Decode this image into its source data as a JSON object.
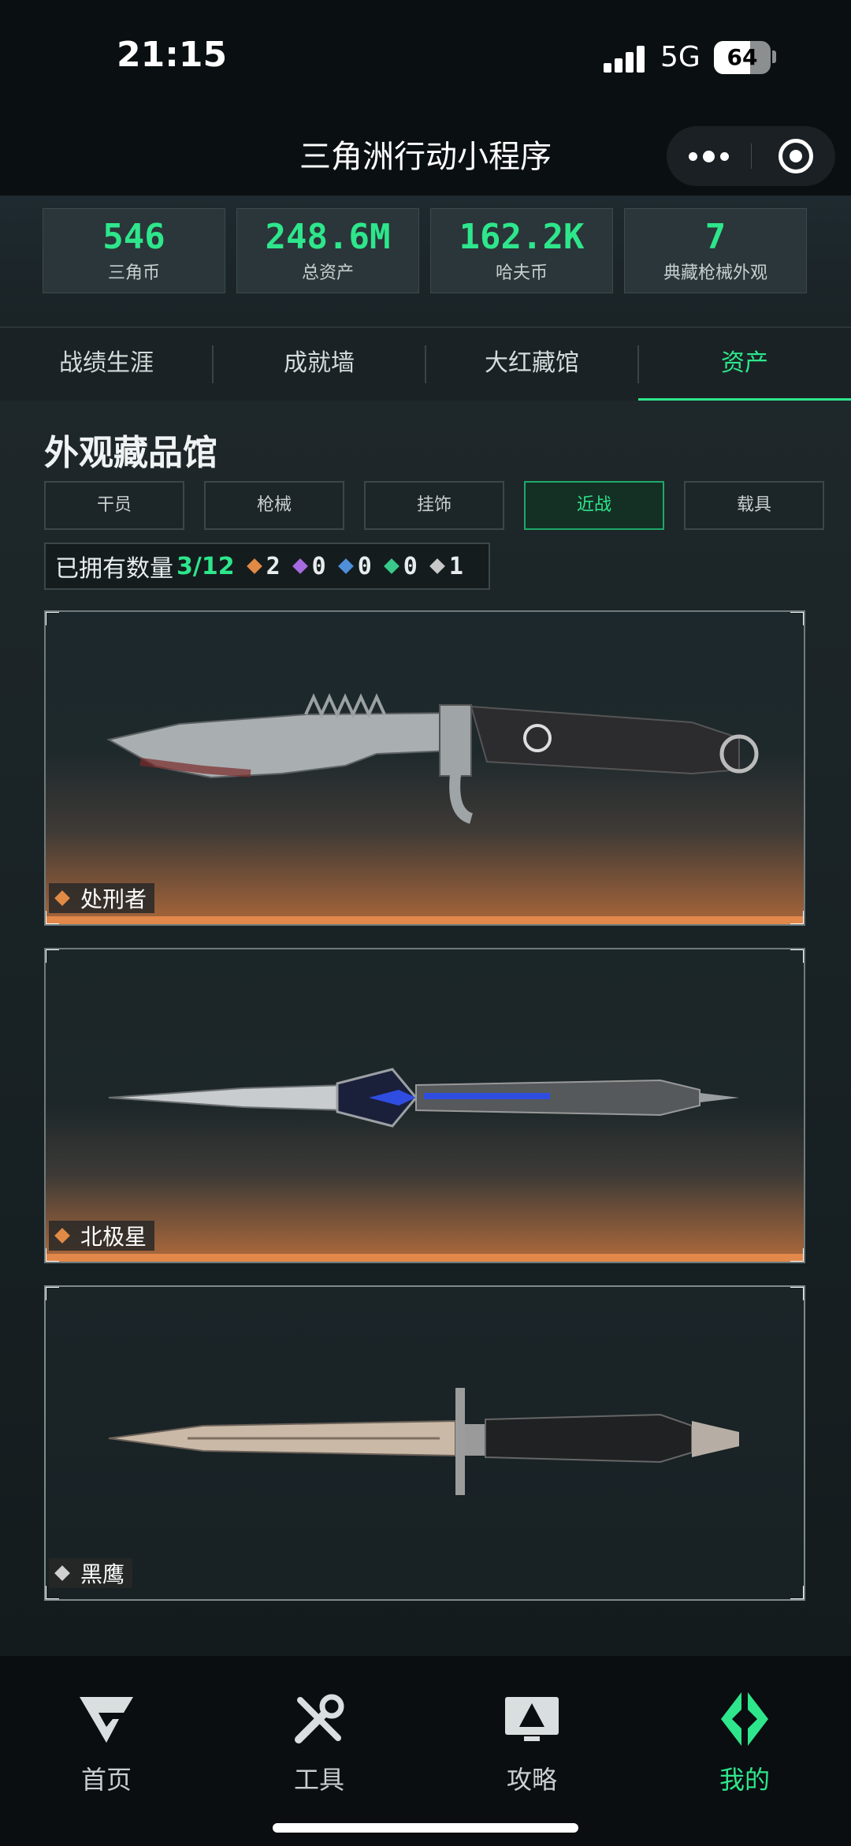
{
  "status_bar": {
    "time": "21:15",
    "network": "5G",
    "battery": "64",
    "battery_level": 0.64
  },
  "nav": {
    "title": "三角洲行动小程序"
  },
  "stats": [
    {
      "value": "546",
      "label": "三角币"
    },
    {
      "value": "248.6M",
      "label": "总资产"
    },
    {
      "value": "162.2K",
      "label": "哈夫币"
    },
    {
      "value": "7",
      "label": "典藏枪械外观"
    }
  ],
  "tabs": [
    {
      "label": "战绩生涯",
      "active": false
    },
    {
      "label": "成就墙",
      "active": false
    },
    {
      "label": "大红藏馆",
      "active": false
    },
    {
      "label": "资产",
      "active": true
    }
  ],
  "section": {
    "title": "外观藏品馆",
    "categories": [
      {
        "label": "干员",
        "active": false
      },
      {
        "label": "枪械",
        "active": false
      },
      {
        "label": "挂饰",
        "active": false
      },
      {
        "label": "近战",
        "active": true
      },
      {
        "label": "载具",
        "active": false
      }
    ],
    "owned": {
      "label": "已拥有数量",
      "count": "3/12",
      "rarities": [
        {
          "count": "2",
          "color": "#e08a45"
        },
        {
          "count": "0",
          "color": "#a66be0"
        },
        {
          "count": "0",
          "color": "#4e8fd8"
        },
        {
          "count": "0",
          "color": "#39c98a"
        },
        {
          "count": "1",
          "color": "#c8c8c8"
        }
      ]
    }
  },
  "knives": [
    {
      "name": "处刑者",
      "rarity_color": "#e08a45"
    },
    {
      "name": "北极星",
      "rarity_color": "#e08a45"
    },
    {
      "name": "黑鹰",
      "rarity_color": "#d0d0d0"
    }
  ],
  "bottom_nav": [
    {
      "label": "首页",
      "icon": "delta-logo-icon",
      "active": false
    },
    {
      "label": "工具",
      "icon": "tools-icon",
      "active": false
    },
    {
      "label": "攻略",
      "icon": "guide-monitor-icon",
      "active": false
    },
    {
      "label": "我的",
      "icon": "profile-brand-icon",
      "active": true
    }
  ],
  "colors": {
    "accent": "#2ee68b",
    "orange": "#e08a45"
  }
}
